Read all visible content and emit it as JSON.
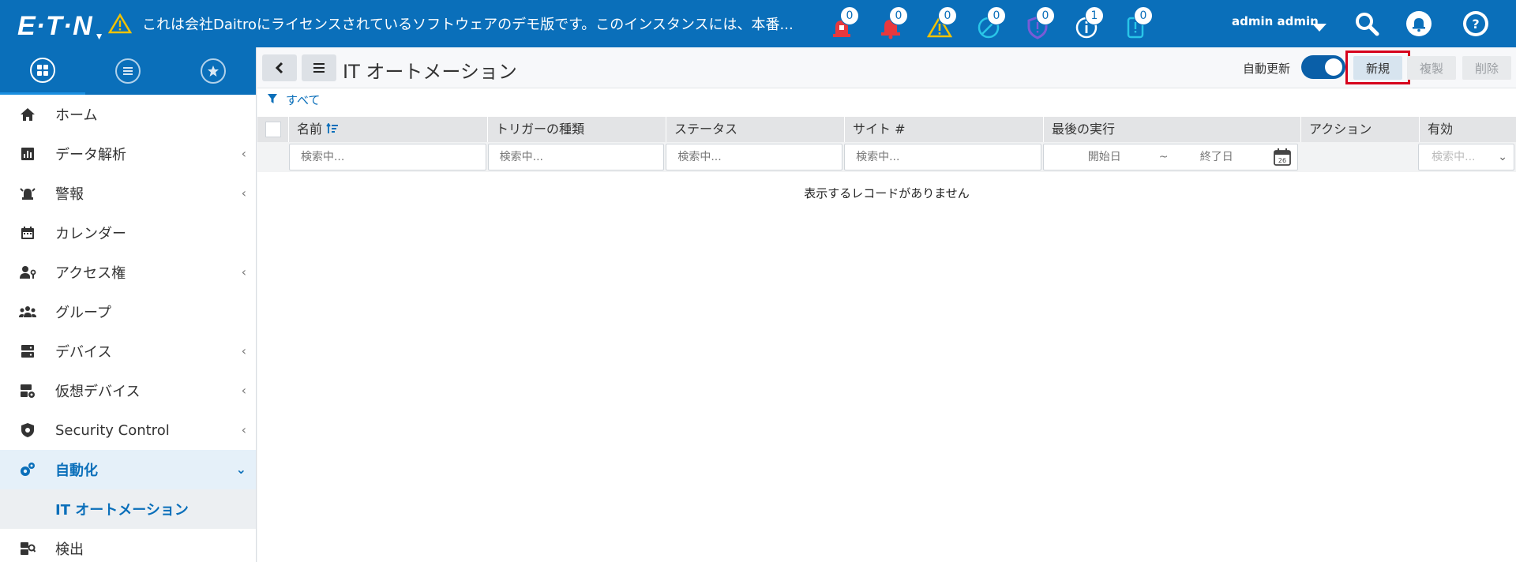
{
  "header": {
    "logo": "E·T·N",
    "banner": "これは会社Daitroにライセンスされているソフトウェアのデモ版です。このインスタンスには、本番...",
    "alerts": [
      {
        "icon": "lock-alarm-icon",
        "count": "0"
      },
      {
        "icon": "bell-alarm-icon",
        "count": "0"
      },
      {
        "icon": "warning-icon",
        "count": "0"
      },
      {
        "icon": "no-signal-icon",
        "count": "0"
      },
      {
        "icon": "shield-alert-icon",
        "count": "0"
      },
      {
        "icon": "info-icon",
        "count": "1"
      },
      {
        "icon": "device-alert-icon",
        "count": "0"
      }
    ],
    "user": "admin admin",
    "colors": {
      "bar": "#0a6fba",
      "alarm_red": "#e8383d",
      "warning_yellow": "#f2c200",
      "info_purple": "#7a5bd6",
      "teal": "#29c6e8"
    }
  },
  "sidebar": {
    "items": [
      {
        "label": "ホーム",
        "icon": "home-icon",
        "expandable": false
      },
      {
        "label": "データ解析",
        "icon": "chart-icon",
        "expandable": true
      },
      {
        "label": "警報",
        "icon": "alarm-icon",
        "expandable": true
      },
      {
        "label": "カレンダー",
        "icon": "calendar-icon",
        "expandable": false
      },
      {
        "label": "アクセス権",
        "icon": "user-key-icon",
        "expandable": true
      },
      {
        "label": "グループ",
        "icon": "group-icon",
        "expandable": false
      },
      {
        "label": "デバイス",
        "icon": "server-icon",
        "expandable": true
      },
      {
        "label": "仮想デバイス",
        "icon": "virtual-device-icon",
        "expandable": true
      },
      {
        "label": "Security Control",
        "icon": "shield-icon",
        "expandable": true
      },
      {
        "label": "自動化",
        "icon": "gears-icon",
        "expandable": true,
        "active": true
      }
    ],
    "sub_item": "IT オートメーション",
    "last_item": {
      "label": "検出",
      "icon": "discover-icon"
    }
  },
  "toolbar": {
    "title": "IT オートメーション",
    "auto_refresh": "自動更新",
    "new_label": "新規",
    "copy_label": "複製",
    "delete_label": "削除"
  },
  "filter": {
    "label": "すべて"
  },
  "table": {
    "columns": [
      "名前",
      "トリガーの種類",
      "ステータス",
      "サイト #",
      "最後の実行",
      "アクション",
      "有効"
    ],
    "search_placeholder": "検索中...",
    "date_start": "開始日",
    "date_sep": "~",
    "date_end": "終了日",
    "calendar_day": "26",
    "enabled_placeholder": "検索中...",
    "empty": "表示するレコードがありません"
  }
}
